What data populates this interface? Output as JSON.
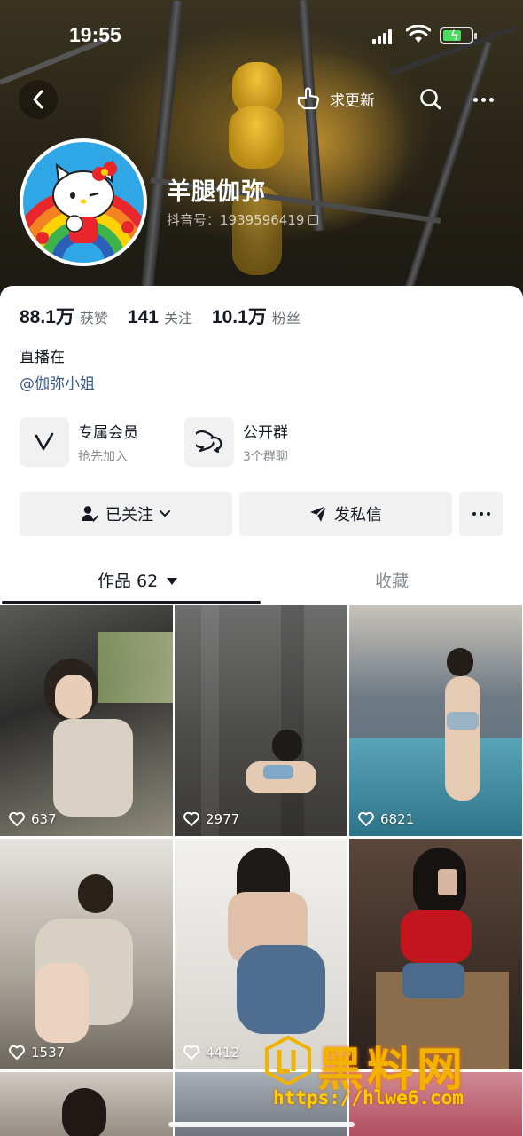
{
  "status_bar": {
    "time": "19:55"
  },
  "nav": {
    "update_label": "求更新"
  },
  "profile": {
    "nickname": "羊腿伽弥",
    "douyin_id": "抖音号：1939596419"
  },
  "stats": [
    {
      "value": "88.1万",
      "label": "获赞"
    },
    {
      "value": "141",
      "label": "关注"
    },
    {
      "value": "10.1万",
      "label": "粉丝"
    }
  ],
  "bio": {
    "line1": "直播在",
    "line2": "@伽弥小姐"
  },
  "features": [
    {
      "title": "专属会员",
      "subtitle": "抢先加入",
      "icon": "v-membership-icon"
    },
    {
      "title": "公开群",
      "subtitle": "3个群聊",
      "icon": "chat-group-icon"
    }
  ],
  "actions": {
    "follow_label": "已关注",
    "message_label": "发私信"
  },
  "tabs": {
    "works_label": "作品 62",
    "favorites_label": "收藏"
  },
  "videos": [
    {
      "likes": "637"
    },
    {
      "likes": "2977"
    },
    {
      "likes": "6821"
    },
    {
      "likes": "1537"
    },
    {
      "likes": "4412"
    },
    {
      "likes": ""
    }
  ],
  "watermark": {
    "title": "黑料网",
    "url": "https://hlwe6.com"
  },
  "colors": {
    "accent_link": "#3a5a8c",
    "button_bg": "#f1f1f2",
    "battery_green": "#4cd964"
  }
}
